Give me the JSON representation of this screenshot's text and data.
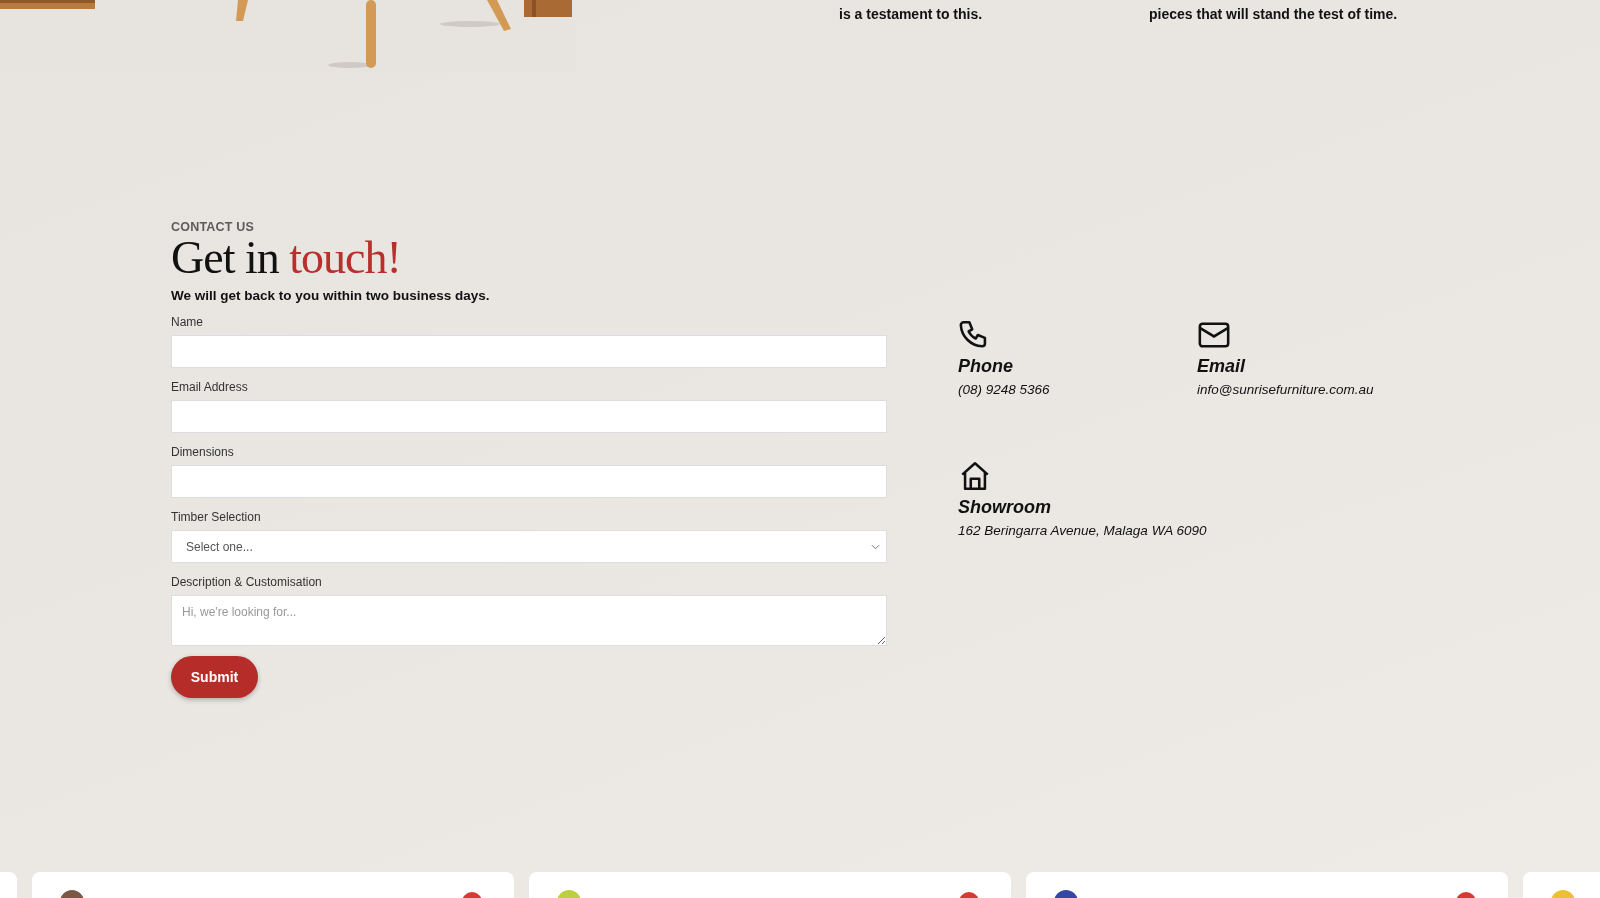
{
  "intro": {
    "texts": [
      "is a testament to this.",
      "pieces that will stand the test of time."
    ]
  },
  "contact": {
    "eyebrow": "CONTACT US",
    "heading": "Get in",
    "heading_accent": "touch!",
    "subtitle": "We will get back to you within two business days.",
    "fields": [
      {
        "kind": "text",
        "label": "Name"
      },
      {
        "kind": "text",
        "label": "Email Address"
      },
      {
        "kind": "text",
        "label": "Dimensions"
      },
      {
        "kind": "select",
        "label": "Timber Selection",
        "placeholder": "Select one..."
      },
      {
        "kind": "textarea",
        "label": "Description & Customisation",
        "placeholder": "Hi, we're looking for..."
      }
    ],
    "submit": "Submit"
  },
  "info": [
    {
      "kind": "phone",
      "title": "Phone",
      "value": "(08) 9248 5366"
    },
    {
      "kind": "email",
      "title": "Email",
      "value": "info@sunrisefurniture.com.au"
    },
    {
      "kind": "home",
      "title": "Showroom",
      "value": "162 Beringarra Avenue, Malaga WA 6090"
    }
  ],
  "cards": [
    {
      "color": "#7a5846"
    },
    {
      "color": "#bccf3c"
    },
    {
      "color": "#3447a6"
    },
    {
      "color": "#ecc02e"
    }
  ]
}
